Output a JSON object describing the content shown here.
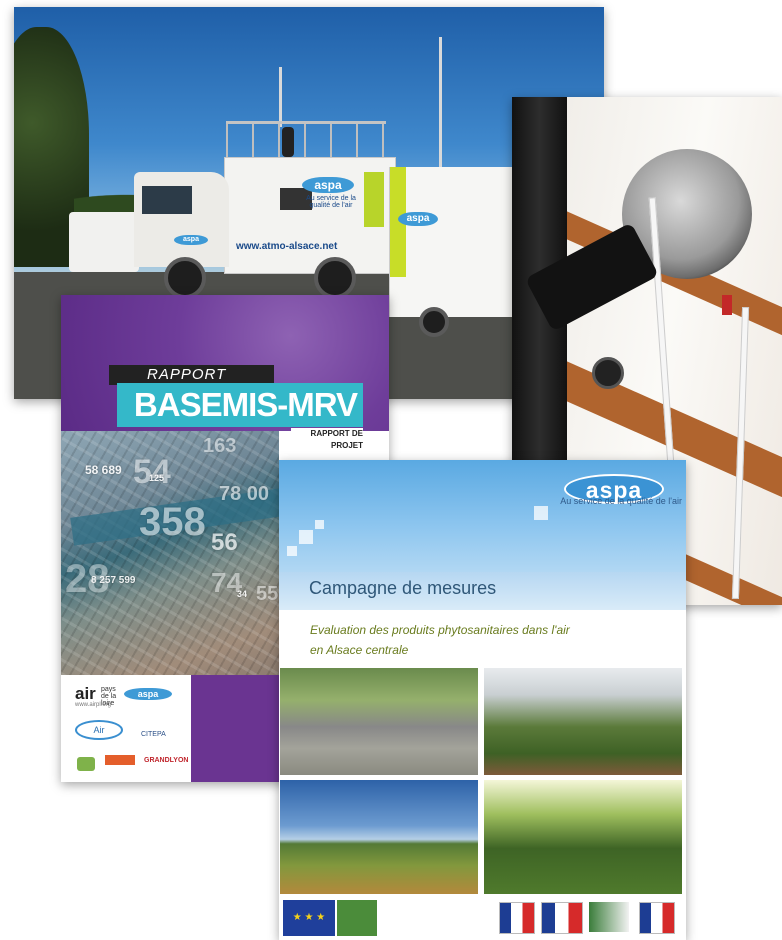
{
  "truck_photo": {
    "badge_cab": "aspa",
    "badge_box": "aspa",
    "badge_box_tagline": "Au service de la qualité de l'air",
    "badge_trailer": "aspa",
    "url": "www.atmo-alsace.net"
  },
  "basemis_cover": {
    "rapport_label": "RAPPORT",
    "title": "BASEMIS-MRV",
    "subtitle": "RAPPORT DE PROJET",
    "numbers": [
      "58 689",
      "54",
      "125",
      "163",
      "78 00",
      "358",
      "56",
      "8 257 599",
      "28",
      "74",
      "55",
      "34"
    ],
    "logos": {
      "air_pays": "air",
      "air_pays_sub": "pays de la loire",
      "air_url": "www.airpl.org",
      "aspa": "aspa",
      "air_rhone": "Air",
      "citepa": "CITEPA",
      "grand_lyon": "GRANDLYON"
    }
  },
  "campagne_cover": {
    "logo": "aspa",
    "tagline": "Au service de la qualité de l'air",
    "title": "Campagne de mesures",
    "subtitle_line1": "Evaluation des produits phytosanitaires dans l'air",
    "subtitle_line2": "en Alsace centrale"
  }
}
